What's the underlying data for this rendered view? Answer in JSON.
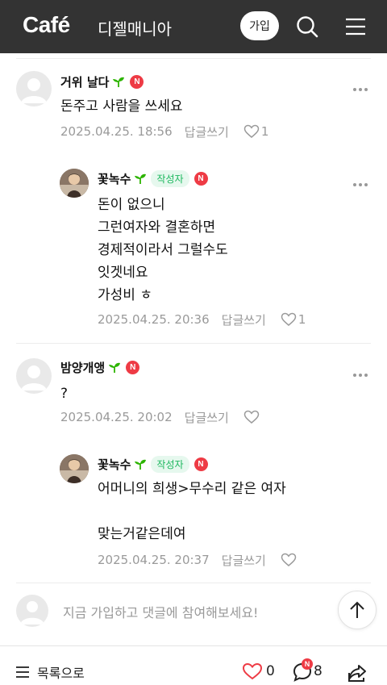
{
  "header": {
    "logo": "Café",
    "cafe_name": "디젤매니아",
    "join_label": "가입",
    "bg_color": "#333333"
  },
  "comments": [
    {
      "nickname": "거위 날다",
      "is_author": false,
      "body": "돈주고 사람을 쓰세요",
      "date": "2025.04.25. 18:56",
      "reply_label": "답글쓰기",
      "likes": "1"
    },
    {
      "nickname": "꽃녹수",
      "is_author": true,
      "author_label": "작성자",
      "body": "돈이 없으니\n그런여자와 결혼하면\n경제적이라서 그럴수도\n잇겟네요\n가성비 ㅎ",
      "date": "2025.04.25. 20:36",
      "reply_label": "답글쓰기",
      "likes": "1"
    },
    {
      "nickname": "밤양개앵",
      "is_author": false,
      "body": "?",
      "date": "2025.04.25. 20:02",
      "reply_label": "답글쓰기",
      "likes": ""
    },
    {
      "nickname": "꽃녹수",
      "is_author": true,
      "author_label": "작성자",
      "body": "어머니의 희생>무수리 같은 여자\n\n맞는거같은데여",
      "date": "2025.04.25. 20:37",
      "reply_label": "답글쓰기",
      "likes": ""
    }
  ],
  "badge_letter": "N",
  "write": {
    "placeholder": "지금 가입하고 댓글에 참여해보세요!"
  },
  "bottom": {
    "list_label": "목록으로",
    "like_count": "0",
    "comment_count": "8",
    "comment_badge": "N"
  },
  "colors": {
    "accent_red": "#ee3b45",
    "author_green": "#1cb75d",
    "meta_gray": "#9a9a9a"
  }
}
